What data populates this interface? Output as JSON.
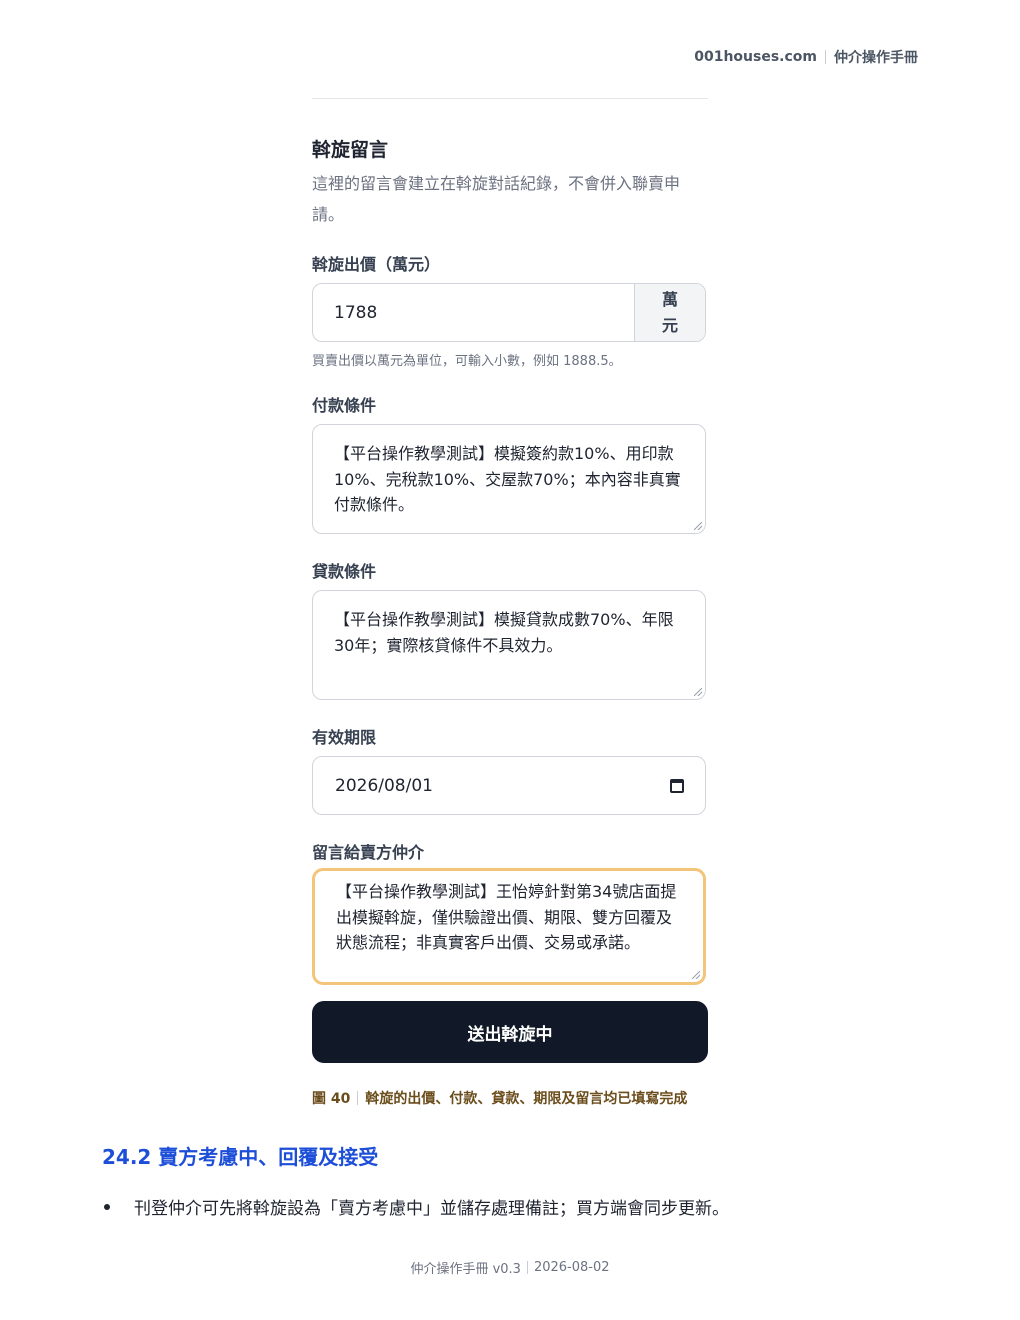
{
  "header": {
    "site": "001houses.com",
    "manual_title": "仲介操作手冊"
  },
  "form": {
    "section_title": "斡旋留言",
    "section_desc": "這裡的留言會建立在斡旋對話紀錄，不會併入聯賣申請。",
    "price": {
      "label": "斡旋出價（萬元）",
      "value": "1788",
      "unit_line1": "萬",
      "unit_line2": "元",
      "hint": "買賣出價以萬元為單位，可輸入小數，例如 1888.5。"
    },
    "payment": {
      "label": "付款條件",
      "value": "【平台操作教學測試】模擬簽約款10%、用印款10%、完稅款10%、交屋款70%；本內容非真實付款條件。"
    },
    "loan": {
      "label": "貸款條件",
      "value": "【平台操作教學測試】模擬貸款成數70%、年限30年；實際核貸條件不具效力。"
    },
    "expiry": {
      "label": "有效期限",
      "value": "2026/08/01"
    },
    "message": {
      "label": "留言給賣方仲介",
      "value": "【平台操作教學測試】王怡婷針對第34號店面提出模擬斡旋，僅供驗證出價、期限、雙方回覆及狀態流程；非真實客戶出價、交易或承諾。"
    },
    "submit_label": "送出斡旋中"
  },
  "caption": {
    "figure": "圖 40",
    "text": "斡旋的出價、付款、貸款、期限及留言均已填寫完成"
  },
  "section": {
    "heading": "24.2 賣方考慮中、回覆及接受",
    "bullet": "刊登仲介可先將斡旋設為「賣方考慮中」並儲存處理備註；買方端會同步更新。"
  },
  "footer": {
    "version": "仲介操作手冊 v0.3",
    "date": "2026-08-02"
  },
  "colors": {
    "accent_heading": "#1d4ed8",
    "caption": "#6b4d1c",
    "submit_bg": "#111827",
    "focus_border": "#f2c57a"
  }
}
